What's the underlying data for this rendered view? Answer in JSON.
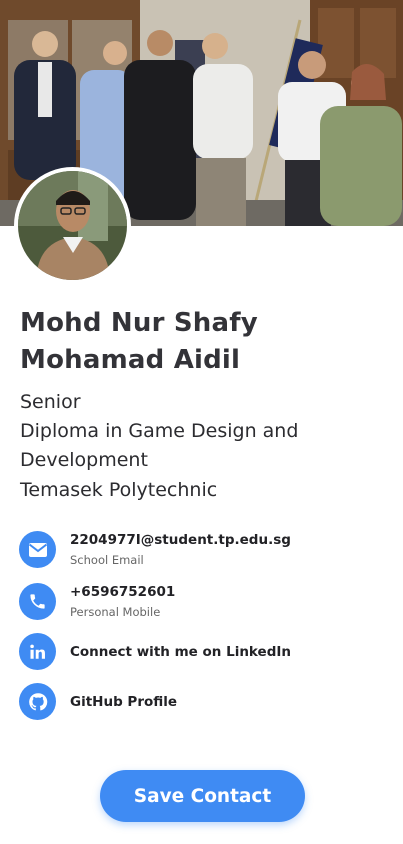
{
  "profile": {
    "name_line1": "Mohd Nur Shafy",
    "name_line2": "Mohamad Aidil",
    "level": "Senior",
    "course_line1": "Diploma in Game Design and",
    "course_line2": "Development",
    "school": "Temasek Polytechnic"
  },
  "contacts": [
    {
      "icon": "email-icon",
      "value": "2204977I@student.tp.edu.sg",
      "label": "School Email"
    },
    {
      "icon": "phone-icon",
      "value": "+6596752601",
      "label": "Personal Mobile"
    },
    {
      "icon": "linkedin-icon",
      "value": "Connect with me on LinkedIn"
    },
    {
      "icon": "github-icon",
      "value": "GitHub Profile"
    }
  ],
  "actions": {
    "save_label": "Save Contact"
  },
  "theme": {
    "accent": "#3f8bf3"
  }
}
